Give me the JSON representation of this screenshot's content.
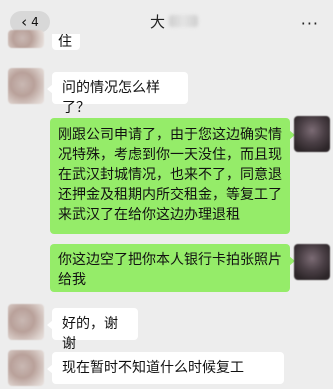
{
  "header": {
    "unread_count": "4",
    "back_icon": "chevron-left-icon",
    "title_visible": "大",
    "more_icon": "ellipsis-icon"
  },
  "messages": [
    {
      "side": "in",
      "text": "住"
    },
    {
      "side": "in",
      "text": "问的情况怎么样了？"
    },
    {
      "side": "out",
      "text": "刚跟公司申请了，由于您这边确实情况特殊，考虑到你一天没住，而且现在武汉封城情况，也来不了，同意退还押金及租期内所交租金，等复工了来武汉了在给你这边办理退租"
    },
    {
      "side": "out",
      "text": "你这边空了把你本人银行卡拍张照片给我"
    },
    {
      "side": "in",
      "text": "好的，谢谢"
    },
    {
      "side": "in",
      "text": "现在暂时不知道什么时候复工"
    }
  ],
  "colors": {
    "background": "#ededed",
    "incoming_bubble": "#ffffff",
    "outgoing_bubble": "#95ec69"
  }
}
